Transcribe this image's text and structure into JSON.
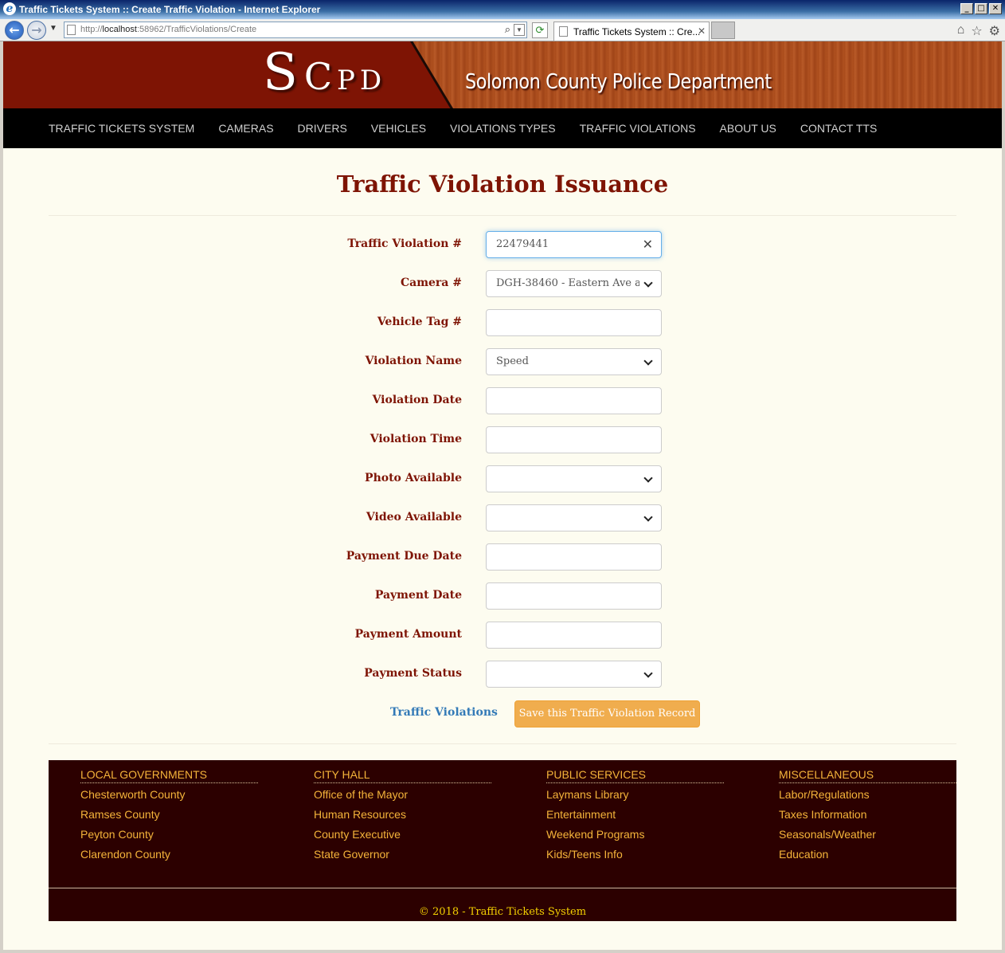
{
  "window": {
    "title": "Traffic Tickets System :: Create Traffic Violation - Internet Explorer",
    "url_prefix": "http://",
    "url_host": "localhost",
    "url_rest": ":58962/TrafficViolations/Create",
    "tab_title": "Traffic Tickets System :: Cre...",
    "win_min": "_",
    "win_max": "□",
    "win_close": "✕"
  },
  "banner": {
    "logo_s": "S",
    "logo_c": "C",
    "logo_pd": "PD",
    "department": "Solomon County Police Department"
  },
  "nav": [
    "TRAFFIC TICKETS SYSTEM",
    "CAMERAS",
    "DRIVERS",
    "VEHICLES",
    "VIOLATIONS TYPES",
    "TRAFFIC VIOLATIONS",
    "ABOUT US",
    "CONTACT TTS"
  ],
  "page_title": "Traffic Violation Issuance",
  "form": {
    "traffic_violation_no": {
      "label": "Traffic Violation #",
      "value": "22479441"
    },
    "camera_no": {
      "label": "Camera #",
      "value": "DGH-38460 - Eastern Ave a"
    },
    "vehicle_tag_no": {
      "label": "Vehicle Tag #",
      "value": ""
    },
    "violation_name": {
      "label": "Violation Name",
      "value": "Speed"
    },
    "violation_date": {
      "label": "Violation Date",
      "value": ""
    },
    "violation_time": {
      "label": "Violation Time",
      "value": ""
    },
    "photo_available": {
      "label": "Photo Available",
      "value": ""
    },
    "video_available": {
      "label": "Video Available",
      "value": ""
    },
    "payment_due_date": {
      "label": "Payment Due Date",
      "value": ""
    },
    "payment_date": {
      "label": "Payment Date",
      "value": ""
    },
    "payment_amount": {
      "label": "Payment Amount",
      "value": ""
    },
    "payment_status": {
      "label": "Payment Status",
      "value": ""
    }
  },
  "actions": {
    "back_link": "Traffic Violations",
    "save_button": "Save this Traffic Violation Record"
  },
  "footer": {
    "columns": [
      {
        "heading": "LOCAL GOVERNMENTS",
        "links": [
          "Chesterworth County",
          "Ramses County",
          "Peyton County",
          "Clarendon County"
        ]
      },
      {
        "heading": "CITY HALL",
        "links": [
          "Office of the Mayor",
          "Human Resources",
          "County Executive",
          "State Governor"
        ]
      },
      {
        "heading": "PUBLIC SERVICES",
        "links": [
          "Laymans Library",
          "Entertainment",
          "Weekend Programs",
          "Kids/Teens Info"
        ]
      },
      {
        "heading": "MISCELLANEOUS",
        "links": [
          "Labor/Regulations",
          "Taxes Information",
          "Seasonals/Weather",
          "Education"
        ]
      }
    ],
    "copyright": "© 2018 - Traffic Tickets System"
  },
  "colors": {
    "brand_dark_red": "#7e1404",
    "footer_bg": "#2c0000",
    "footer_link": "#f4b43a",
    "save_button": "#f0ad4e",
    "link_blue": "#337ab7"
  }
}
